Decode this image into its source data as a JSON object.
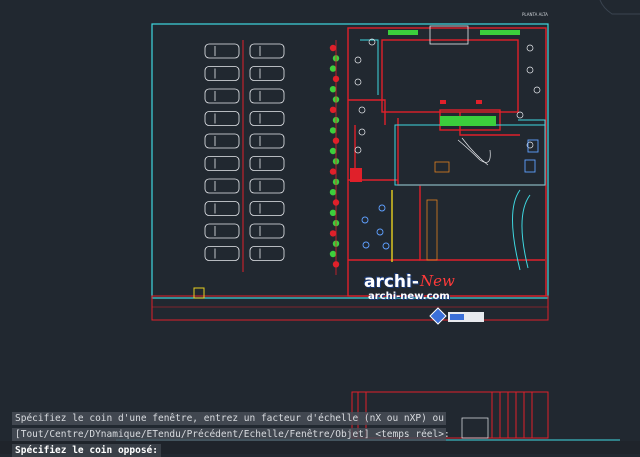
{
  "window": {
    "background": "#212830"
  },
  "drawing": {
    "plan_label": "PLANTA ALTA",
    "logo": {
      "main": "archi-",
      "accent": "New",
      "url": "archi-new.com"
    },
    "colors": {
      "cyan": "#3fd8e0",
      "red": "#e0202a",
      "white": "#e8eaee",
      "green": "#3ccf3c",
      "yellow": "#e8d020"
    }
  },
  "command_line": {
    "history_1": "Spécifiez le coin d'une fenêtre, entrez un facteur d'échelle (nX ou nXP) ou",
    "history_2": "[Tout/Centre/DYnamique/ETendu/Précédent/Echelle/Fenêtre/Objet] <temps réel>:",
    "prompt": "Spécifiez le coin opposé:"
  }
}
